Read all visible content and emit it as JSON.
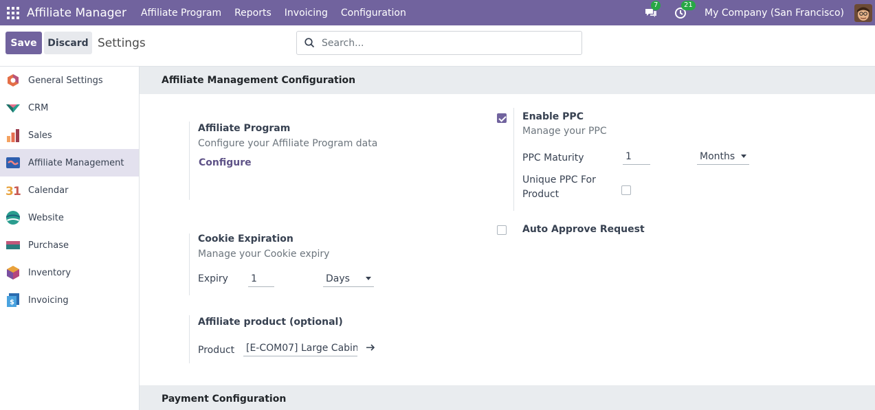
{
  "topbar": {
    "app_name": "Affiliate Manager",
    "menu": [
      "Affiliate Program",
      "Reports",
      "Invoicing",
      "Configuration"
    ],
    "chat_count": "7",
    "activity_count": "21",
    "company": "My Company (San Francisco)"
  },
  "control": {
    "save_label": "Save",
    "discard_label": "Discard",
    "title": "Settings",
    "search_placeholder": "Search..."
  },
  "sidebar": {
    "items": [
      {
        "label": "General Settings",
        "icon": "odoo-settings-icon"
      },
      {
        "label": "CRM",
        "icon": "crm-icon"
      },
      {
        "label": "Sales",
        "icon": "sales-chart-icon"
      },
      {
        "label": "Affiliate Management",
        "icon": "affiliate-icon",
        "active": true
      },
      {
        "label": "Calendar",
        "icon": "calendar-icon"
      },
      {
        "label": "Website",
        "icon": "website-icon"
      },
      {
        "label": "Purchase",
        "icon": "purchase-icon"
      },
      {
        "label": "Inventory",
        "icon": "inventory-box-icon"
      },
      {
        "label": "Invoicing",
        "icon": "invoice-icon"
      }
    ]
  },
  "main": {
    "section1_title": "Affiliate Management Configuration",
    "affiliate_program": {
      "label": "Affiliate Program",
      "desc": "Configure your Affiliate Program data",
      "link": "Configure"
    },
    "ppc": {
      "label": "Enable PPC",
      "desc": "Manage your PPC",
      "checked": true,
      "maturity_label": "PPC Maturity",
      "maturity_value": "1",
      "maturity_unit": "Months",
      "unique_label": "Unique PPC For Product",
      "unique_checked": false
    },
    "auto_approve": {
      "label": "Auto Approve Request",
      "checked": false
    },
    "cookie": {
      "label": "Cookie Expiration",
      "desc": "Manage your Cookie expiry",
      "expiry_label": "Expiry",
      "expiry_value": "1",
      "expiry_unit": "Days"
    },
    "product": {
      "label": "Affiliate product (optional)",
      "field_label": "Product",
      "value": "[E-COM07] Large Cabin"
    },
    "section2_title": "Payment Configuration"
  },
  "colors": {
    "brand": "#71639e",
    "active_bg": "#e3e1ee",
    "badge": "#28a745"
  }
}
